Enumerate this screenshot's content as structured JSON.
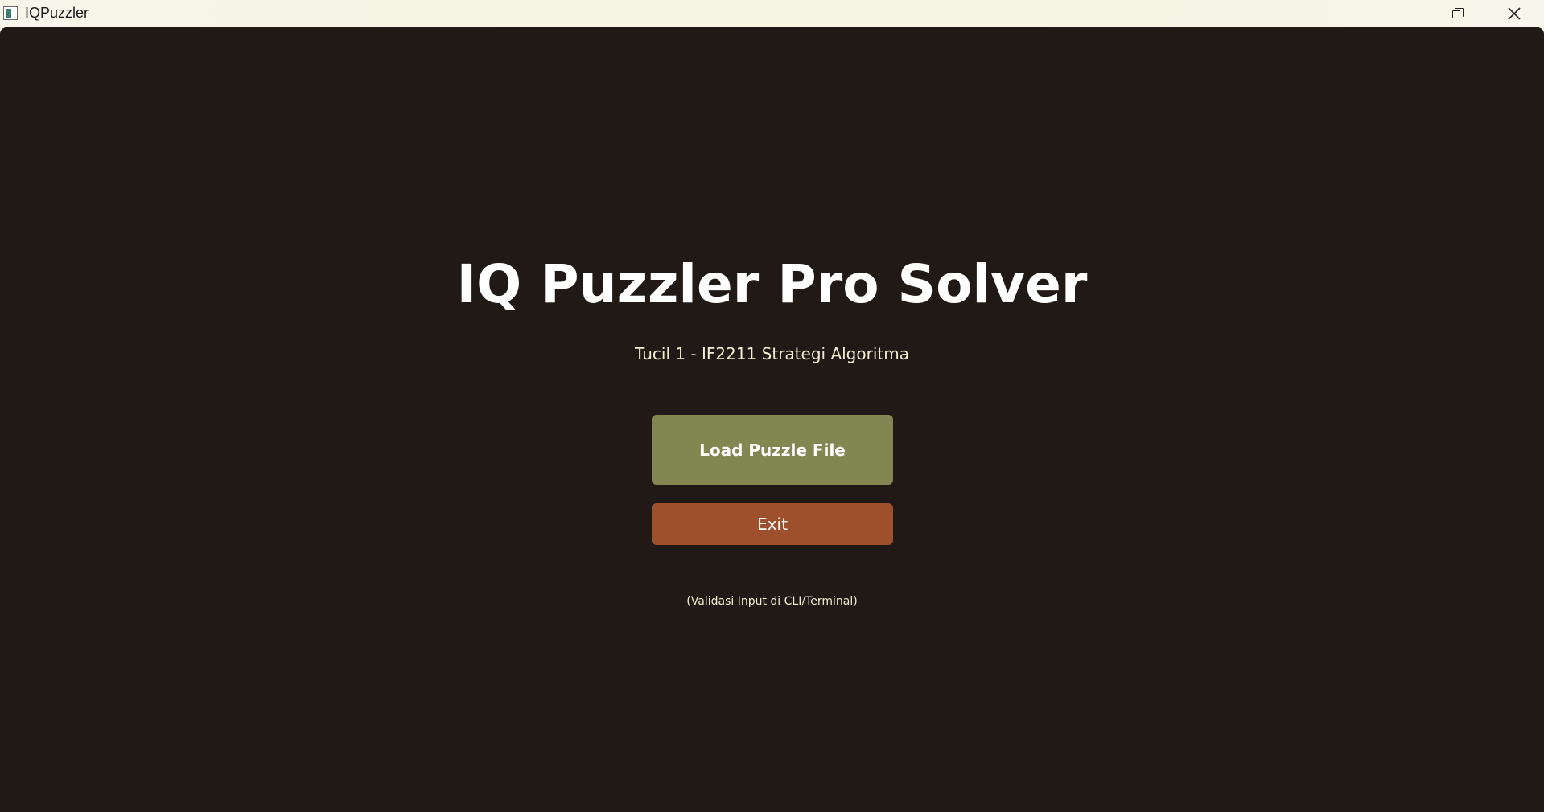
{
  "window": {
    "title": "IQPuzzler",
    "controls": {
      "minimize_icon": "minimize-icon",
      "maximize_icon": "restore-icon",
      "close_icon": "close-icon"
    }
  },
  "main": {
    "title": "IQ Puzzler Pro Solver",
    "subtitle": "Tucil 1 - IF2211 Strategi Algoritma",
    "load_button_label": "Load Puzzle File",
    "exit_button_label": "Exit",
    "note": "(Validasi Input di CLI/Terminal)"
  },
  "colors": {
    "background": "#201915",
    "load_button": "#828752",
    "exit_button": "#9e502d",
    "text_primary": "#ffffff",
    "text_secondary": "#f3ecd2"
  }
}
